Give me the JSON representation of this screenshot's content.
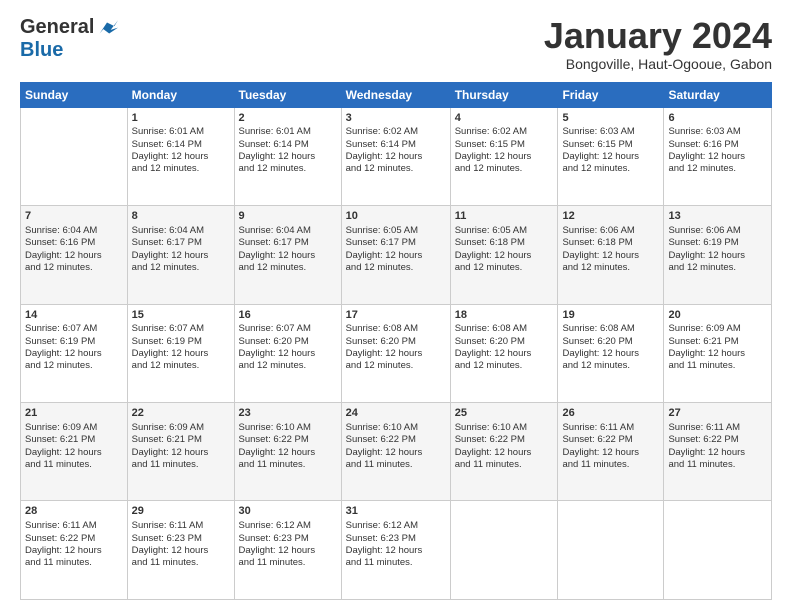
{
  "logo": {
    "general": "General",
    "blue": "Blue"
  },
  "header": {
    "title": "January 2024",
    "subtitle": "Bongoville, Haut-Ogooue, Gabon"
  },
  "days_of_week": [
    "Sunday",
    "Monday",
    "Tuesday",
    "Wednesday",
    "Thursday",
    "Friday",
    "Saturday"
  ],
  "weeks": [
    [
      {
        "day": "",
        "info": ""
      },
      {
        "day": "1",
        "info": "Sunrise: 6:01 AM\nSunset: 6:14 PM\nDaylight: 12 hours\nand 12 minutes."
      },
      {
        "day": "2",
        "info": "Sunrise: 6:01 AM\nSunset: 6:14 PM\nDaylight: 12 hours\nand 12 minutes."
      },
      {
        "day": "3",
        "info": "Sunrise: 6:02 AM\nSunset: 6:14 PM\nDaylight: 12 hours\nand 12 minutes."
      },
      {
        "day": "4",
        "info": "Sunrise: 6:02 AM\nSunset: 6:15 PM\nDaylight: 12 hours\nand 12 minutes."
      },
      {
        "day": "5",
        "info": "Sunrise: 6:03 AM\nSunset: 6:15 PM\nDaylight: 12 hours\nand 12 minutes."
      },
      {
        "day": "6",
        "info": "Sunrise: 6:03 AM\nSunset: 6:16 PM\nDaylight: 12 hours\nand 12 minutes."
      }
    ],
    [
      {
        "day": "7",
        "info": "Sunrise: 6:04 AM\nSunset: 6:16 PM\nDaylight: 12 hours\nand 12 minutes."
      },
      {
        "day": "8",
        "info": "Sunrise: 6:04 AM\nSunset: 6:17 PM\nDaylight: 12 hours\nand 12 minutes."
      },
      {
        "day": "9",
        "info": "Sunrise: 6:04 AM\nSunset: 6:17 PM\nDaylight: 12 hours\nand 12 minutes."
      },
      {
        "day": "10",
        "info": "Sunrise: 6:05 AM\nSunset: 6:17 PM\nDaylight: 12 hours\nand 12 minutes."
      },
      {
        "day": "11",
        "info": "Sunrise: 6:05 AM\nSunset: 6:18 PM\nDaylight: 12 hours\nand 12 minutes."
      },
      {
        "day": "12",
        "info": "Sunrise: 6:06 AM\nSunset: 6:18 PM\nDaylight: 12 hours\nand 12 minutes."
      },
      {
        "day": "13",
        "info": "Sunrise: 6:06 AM\nSunset: 6:19 PM\nDaylight: 12 hours\nand 12 minutes."
      }
    ],
    [
      {
        "day": "14",
        "info": "Sunrise: 6:07 AM\nSunset: 6:19 PM\nDaylight: 12 hours\nand 12 minutes."
      },
      {
        "day": "15",
        "info": "Sunrise: 6:07 AM\nSunset: 6:19 PM\nDaylight: 12 hours\nand 12 minutes."
      },
      {
        "day": "16",
        "info": "Sunrise: 6:07 AM\nSunset: 6:20 PM\nDaylight: 12 hours\nand 12 minutes."
      },
      {
        "day": "17",
        "info": "Sunrise: 6:08 AM\nSunset: 6:20 PM\nDaylight: 12 hours\nand 12 minutes."
      },
      {
        "day": "18",
        "info": "Sunrise: 6:08 AM\nSunset: 6:20 PM\nDaylight: 12 hours\nand 12 minutes."
      },
      {
        "day": "19",
        "info": "Sunrise: 6:08 AM\nSunset: 6:20 PM\nDaylight: 12 hours\nand 12 minutes."
      },
      {
        "day": "20",
        "info": "Sunrise: 6:09 AM\nSunset: 6:21 PM\nDaylight: 12 hours\nand 11 minutes."
      }
    ],
    [
      {
        "day": "21",
        "info": "Sunrise: 6:09 AM\nSunset: 6:21 PM\nDaylight: 12 hours\nand 11 minutes."
      },
      {
        "day": "22",
        "info": "Sunrise: 6:09 AM\nSunset: 6:21 PM\nDaylight: 12 hours\nand 11 minutes."
      },
      {
        "day": "23",
        "info": "Sunrise: 6:10 AM\nSunset: 6:22 PM\nDaylight: 12 hours\nand 11 minutes."
      },
      {
        "day": "24",
        "info": "Sunrise: 6:10 AM\nSunset: 6:22 PM\nDaylight: 12 hours\nand 11 minutes."
      },
      {
        "day": "25",
        "info": "Sunrise: 6:10 AM\nSunset: 6:22 PM\nDaylight: 12 hours\nand 11 minutes."
      },
      {
        "day": "26",
        "info": "Sunrise: 6:11 AM\nSunset: 6:22 PM\nDaylight: 12 hours\nand 11 minutes."
      },
      {
        "day": "27",
        "info": "Sunrise: 6:11 AM\nSunset: 6:22 PM\nDaylight: 12 hours\nand 11 minutes."
      }
    ],
    [
      {
        "day": "28",
        "info": "Sunrise: 6:11 AM\nSunset: 6:22 PM\nDaylight: 12 hours\nand 11 minutes."
      },
      {
        "day": "29",
        "info": "Sunrise: 6:11 AM\nSunset: 6:23 PM\nDaylight: 12 hours\nand 11 minutes."
      },
      {
        "day": "30",
        "info": "Sunrise: 6:12 AM\nSunset: 6:23 PM\nDaylight: 12 hours\nand 11 minutes."
      },
      {
        "day": "31",
        "info": "Sunrise: 6:12 AM\nSunset: 6:23 PM\nDaylight: 12 hours\nand 11 minutes."
      },
      {
        "day": "",
        "info": ""
      },
      {
        "day": "",
        "info": ""
      },
      {
        "day": "",
        "info": ""
      }
    ]
  ]
}
